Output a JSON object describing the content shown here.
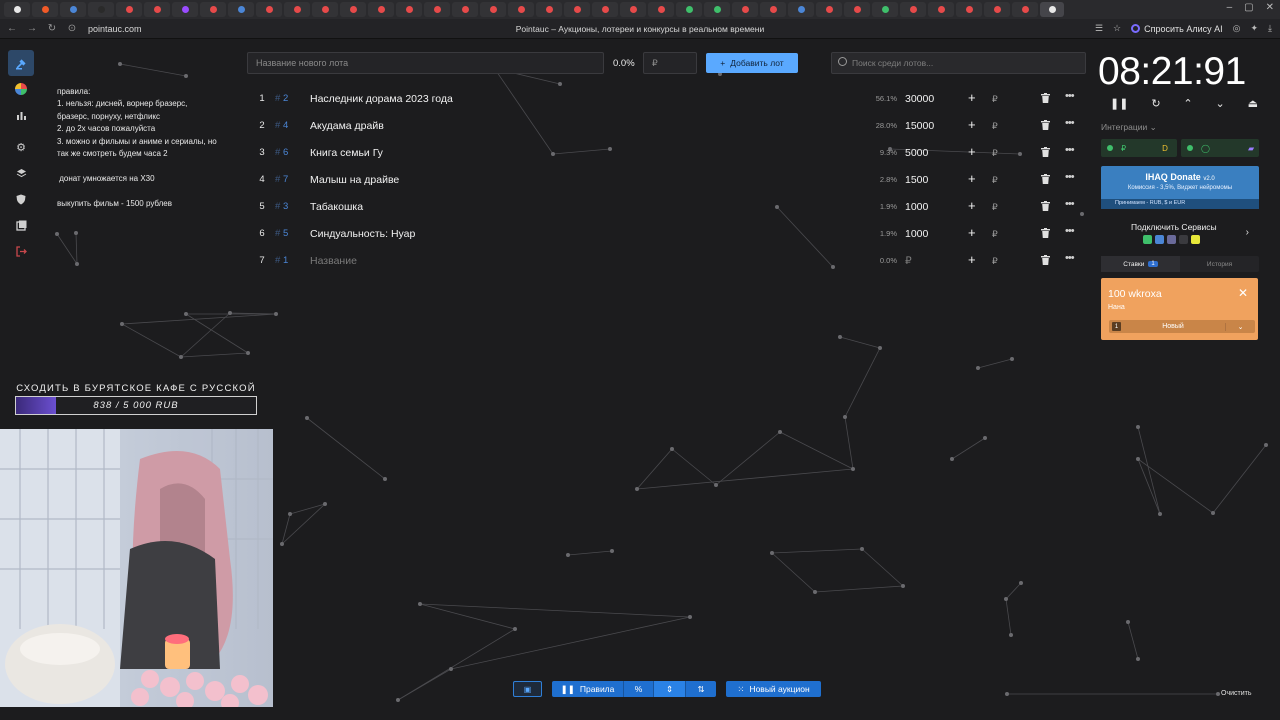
{
  "browser": {
    "url": "pointauc.com",
    "page_title": "Pointauc – Аукционы, лотереи и конкурсы в реальном времени",
    "assistant_label": "Спросить Алису AI"
  },
  "sidebar": [
    "sidebar-auction",
    "sidebar-wheel",
    "sidebar-stats",
    "sidebar-settings",
    "sidebar-layers",
    "sidebar-shield",
    "sidebar-history",
    "sidebar-exit"
  ],
  "rules": {
    "lines": [
      "правила:",
      "1. нельзя: дисней, ворнер бразерс,",
      "бразерс, порнуху, нетфликс",
      "2. до 2х часов пожалуйста",
      "3. можно и фильмы и аниме и сериалы, но",
      "так же смотреть будем часа 2",
      "",
      " донат умножается на Х30",
      "",
      "выкупить фильм - 1500 рублев"
    ]
  },
  "goal": {
    "title": "СХОДИТЬ В БУРЯТСКОЕ КАФЕ С РУССКОЙ",
    "progress_text": "838  /  5  000  RUB",
    "progress_fraction": 0.1676,
    "fill_color": "#5a45b8"
  },
  "lot_form": {
    "name_placeholder": "Название нового лота",
    "percent": "0.0%",
    "money_placeholder": "₽",
    "add_label": "Добавить лот",
    "search_placeholder": "Поиск среди лотов..."
  },
  "lots": [
    {
      "idx": "1",
      "id": "2",
      "name": "Наследник дорама 2023 года",
      "pct": "56.1%",
      "amount": "30000"
    },
    {
      "idx": "2",
      "id": "4",
      "name": "Акудама драйв",
      "pct": "28.0%",
      "amount": "15000"
    },
    {
      "idx": "3",
      "id": "6",
      "name": "Книга семьи Гу",
      "pct": "9.3%",
      "amount": "5000"
    },
    {
      "idx": "4",
      "id": "7",
      "name": "Малыш на драйве",
      "pct": "2.8%",
      "amount": "1500"
    },
    {
      "idx": "5",
      "id": "3",
      "name": "Табакошка",
      "pct": "1.9%",
      "amount": "1000"
    },
    {
      "idx": "6",
      "id": "5",
      "name": "Синдуальность: Нуар",
      "pct": "1.9%",
      "amount": "1000"
    },
    {
      "idx": "7",
      "id": "1",
      "name": "Название",
      "pct": "0.0%",
      "amount": "₽",
      "placeholder": true
    }
  ],
  "lot_currency": "₽",
  "bottom": {
    "rules_label": "Правила",
    "new_auction_label": "Новый аукцион",
    "clear_label": "Очистить"
  },
  "timer": {
    "value": "08:21:91"
  },
  "integrations": {
    "label": "Интеграции",
    "donate_title": "IHAQ Donate",
    "donate_version": "v2.0",
    "donate_sub": "Комиссия - 3,5%, Виджет нейромомы",
    "donate_foot": "Принимаем - RUB, $ и EUR",
    "connect_label": "Подключить Сервисы"
  },
  "bids": {
    "tab_bids": "Ставки",
    "tab_bids_count": "1",
    "tab_history": "История",
    "card_title": "100 wkroxa",
    "card_message": "Нана",
    "select_num": "1",
    "select_label": "Новый"
  },
  "colors": {
    "accent": "#5aa9ff",
    "primary_button": "#1f6fcf",
    "bid_card": "#f0a25e",
    "background": "#1c1c1e"
  }
}
